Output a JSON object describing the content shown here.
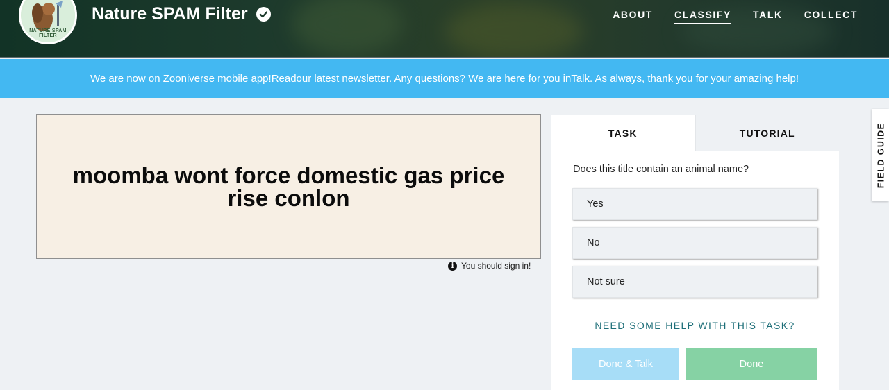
{
  "header": {
    "project_title": "Nature SPAM Filter",
    "avatar_text": "NATURE SPAM FILTER",
    "nav": [
      "ABOUT",
      "CLASSIFY",
      "TALK",
      "COLLECT"
    ],
    "active_nav": "CLASSIFY"
  },
  "banner": {
    "text_1": "We are now on Zooniverse mobile app! ",
    "link_1": "Read",
    "text_2": " our latest newsletter. Any questions? We are here for you in ",
    "link_2": "Talk",
    "text_3": ". As always, thank you for your amazing help!"
  },
  "subject": {
    "text": "moomba wont force domestic gas price rise conlon",
    "signin_notice": "You should sign in!"
  },
  "task": {
    "tabs": [
      "TASK",
      "TUTORIAL"
    ],
    "question": "Does this title contain an animal name?",
    "answers": [
      "Yes",
      "No",
      "Not sure"
    ],
    "help_link": "NEED SOME HELP WITH THIS TASK?",
    "done_talk": "Done & Talk",
    "done": "Done"
  },
  "field_guide": {
    "label": "FIELD GUIDE"
  },
  "colors": {
    "banner": "#43b8f2",
    "done_button": "#86d2a4",
    "done_talk_button": "#a7ddf7",
    "subject_bg": "#f7efe4",
    "help_link": "#1d6e78"
  }
}
